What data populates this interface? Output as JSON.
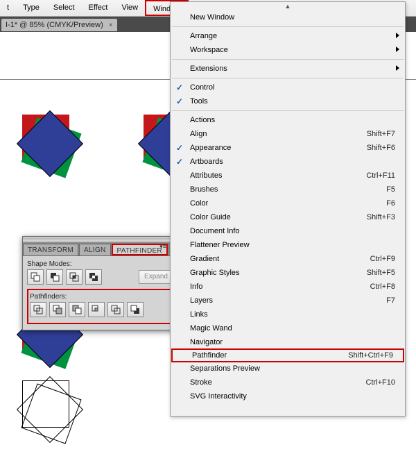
{
  "menubar": {
    "items": [
      "t",
      "Type",
      "Select",
      "Effect",
      "View",
      "Window"
    ]
  },
  "doctab": {
    "label": "I-1* @ 85% (CMYK/Preview)",
    "close": "×"
  },
  "dropdown": {
    "top_arrow": "▲",
    "groups": [
      [
        {
          "label": "New Window"
        }
      ],
      [
        {
          "label": "Arrange",
          "sub": true
        },
        {
          "label": "Workspace",
          "sub": true
        }
      ],
      [
        {
          "label": "Extensions",
          "sub": true
        }
      ],
      [
        {
          "label": "Control",
          "checked": true
        },
        {
          "label": "Tools",
          "checked": true
        }
      ],
      [
        {
          "label": "Actions"
        },
        {
          "label": "Align",
          "shortcut": "Shift+F7"
        },
        {
          "label": "Appearance",
          "shortcut": "Shift+F6",
          "checked": true
        },
        {
          "label": "Artboards",
          "checked": true
        },
        {
          "label": "Attributes",
          "shortcut": "Ctrl+F11"
        },
        {
          "label": "Brushes",
          "shortcut": "F5"
        },
        {
          "label": "Color",
          "shortcut": "F6"
        },
        {
          "label": "Color Guide",
          "shortcut": "Shift+F3"
        },
        {
          "label": "Document Info"
        },
        {
          "label": "Flattener Preview"
        },
        {
          "label": "Gradient",
          "shortcut": "Ctrl+F9"
        },
        {
          "label": "Graphic Styles",
          "shortcut": "Shift+F5"
        },
        {
          "label": "Info",
          "shortcut": "Ctrl+F8"
        },
        {
          "label": "Layers",
          "shortcut": "F7"
        },
        {
          "label": "Links"
        },
        {
          "label": "Magic Wand"
        },
        {
          "label": "Navigator"
        },
        {
          "label": "Pathfinder",
          "shortcut": "Shift+Ctrl+F9",
          "highlight": true
        },
        {
          "label": "Separations Preview"
        },
        {
          "label": "Stroke",
          "shortcut": "Ctrl+F10"
        },
        {
          "label": "SVG Interactivity"
        }
      ]
    ]
  },
  "panel": {
    "tabs": [
      "TRANSFORM",
      "ALIGN",
      "PATHFINDER"
    ],
    "shape_modes_label": "Shape Modes:",
    "expand_label": "Expand",
    "pathfinders_label": "Pathfinders:",
    "close": "x",
    "menu": "▾≡"
  }
}
